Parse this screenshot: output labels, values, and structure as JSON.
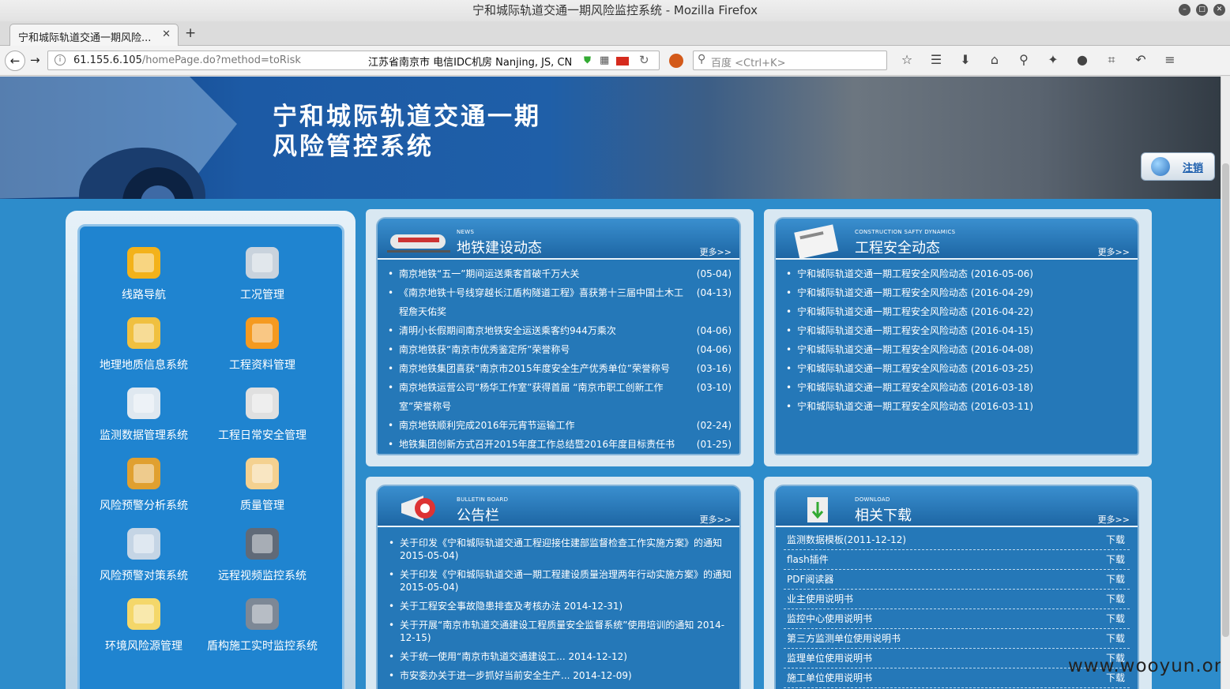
{
  "window": {
    "title": "宁和城际轨道交通一期风险监控系统 - Mozilla Firefox"
  },
  "tab": {
    "label": "宁和城际轨道交通一期风险...",
    "close": "✕",
    "new": "+"
  },
  "nav": {
    "url_host": "61.155.6.105",
    "url_path": "/homePage.do?method=toRisk",
    "geo": "江苏省南京市 电信IDC机房   Nanjing, JS, CN",
    "search_placeholder": "百度 <Ctrl+K>"
  },
  "header": {
    "title_line1": "宁和城际轨道交通一期",
    "title_line2": "风险管控系统",
    "logout": "注销"
  },
  "menu": [
    {
      "label": "线路导航",
      "icon": "blocks-icon"
    },
    {
      "label": "工况管理",
      "icon": "tools-icon"
    },
    {
      "label": "地理地质信息系统",
      "icon": "globe-map-icon"
    },
    {
      "label": "工程资料管理",
      "icon": "books-icon"
    },
    {
      "label": "监测数据管理系统",
      "icon": "magnifier-icon"
    },
    {
      "label": "工程日常安全管理",
      "icon": "megaphone-icon"
    },
    {
      "label": "风险预警分析系统",
      "icon": "bell-icon"
    },
    {
      "label": "质量管理",
      "icon": "clipboard-icon"
    },
    {
      "label": "风险预警对策系统",
      "icon": "monitor-icon"
    },
    {
      "label": "远程视频监控系统",
      "icon": "camera-icon"
    },
    {
      "label": "环境风险源管理",
      "icon": "book-icon"
    },
    {
      "label": "盾构施工实时监控系统",
      "icon": "tunnel-icon"
    }
  ],
  "news": {
    "tag": "NEWS",
    "title": "地铁建设动态",
    "more": "更多>>",
    "items": [
      {
        "text": "南京地铁“五一”期间运送乘客首破千万大关",
        "date": "(05-04)"
      },
      {
        "text": "《南京地铁十号线穿越长江盾构隧道工程》喜获第十三届中国土木工程詹天佑奖",
        "date": "(04-13)"
      },
      {
        "text": "清明小长假期间南京地铁安全运送乘客约944万乘次",
        "date": "(04-06)"
      },
      {
        "text": "南京地铁获“南京市优秀鉴定所”荣誉称号",
        "date": "(04-06)"
      },
      {
        "text": "南京地铁集团喜获“南京市2015年度安全生产优秀单位”荣誉称号",
        "date": "(03-16)"
      },
      {
        "text": "南京地铁运营公司“杨华工作室”获得首届 “南京市职工创新工作室”荣誉称号",
        "date": "(03-10)"
      },
      {
        "text": "南京地铁顺利完成2016年元宵节运输工作",
        "date": "(02-24)"
      },
      {
        "text": "地铁集团创新方式召开2015年度工作总结暨2016年度目标责任书签订",
        "date": "(01-25)"
      }
    ]
  },
  "safety": {
    "tag": "CONSTRUCTION SAFTY DYNAMICS",
    "title": "工程安全动态",
    "more": "更多>>",
    "items": [
      "宁和城际轨道交通一期工程安全风险动态  (2016-05-06)",
      "宁和城际轨道交通一期工程安全风险动态  (2016-04-29)",
      "宁和城际轨道交通一期工程安全风险动态  (2016-04-22)",
      "宁和城际轨道交通一期工程安全风险动态  (2016-04-15)",
      "宁和城际轨道交通一期工程安全风险动态  (2016-04-08)",
      "宁和城际轨道交通一期工程安全风险动态  (2016-03-25)",
      "宁和城际轨道交通一期工程安全风险动态  (2016-03-18)",
      "宁和城际轨道交通一期工程安全风险动态  (2016-03-11)"
    ]
  },
  "bulletin": {
    "tag": "BULLETIN BOARD",
    "title": "公告栏",
    "more": "更多>>",
    "items": [
      "关于印发《宁和城际轨道交通工程迎接住建部监督检查工作实施方案》的通知  2015-05-04)",
      "关于印发《宁和城际轨道交通一期工程建设质量治理两年行动实施方案》的通知  2015-05-04)",
      "关于工程安全事故隐患排查及考核办法  2014-12-31)",
      "关于开展“南京市轨道交通建设工程质量安全监督系统”使用培训的通知  2014-12-15)",
      "关于统一使用“南京市轨道交通建设工...  2014-12-12)",
      "市安委办关于进一步抓好当前安全生产...  2014-12-09)"
    ]
  },
  "download": {
    "tag": "DOWNLOAD",
    "title": "相关下载",
    "more": "更多>>",
    "action": "下载",
    "items": [
      "监测数据模板(2011-12-12)",
      "flash插件",
      "PDF阅读器",
      "业主使用说明书",
      "监控中心使用说明书",
      "第三方监测单位使用说明书",
      "监理单位使用说明书",
      "施工单位使用说明书"
    ]
  },
  "watermark": "www.wooyun.org"
}
